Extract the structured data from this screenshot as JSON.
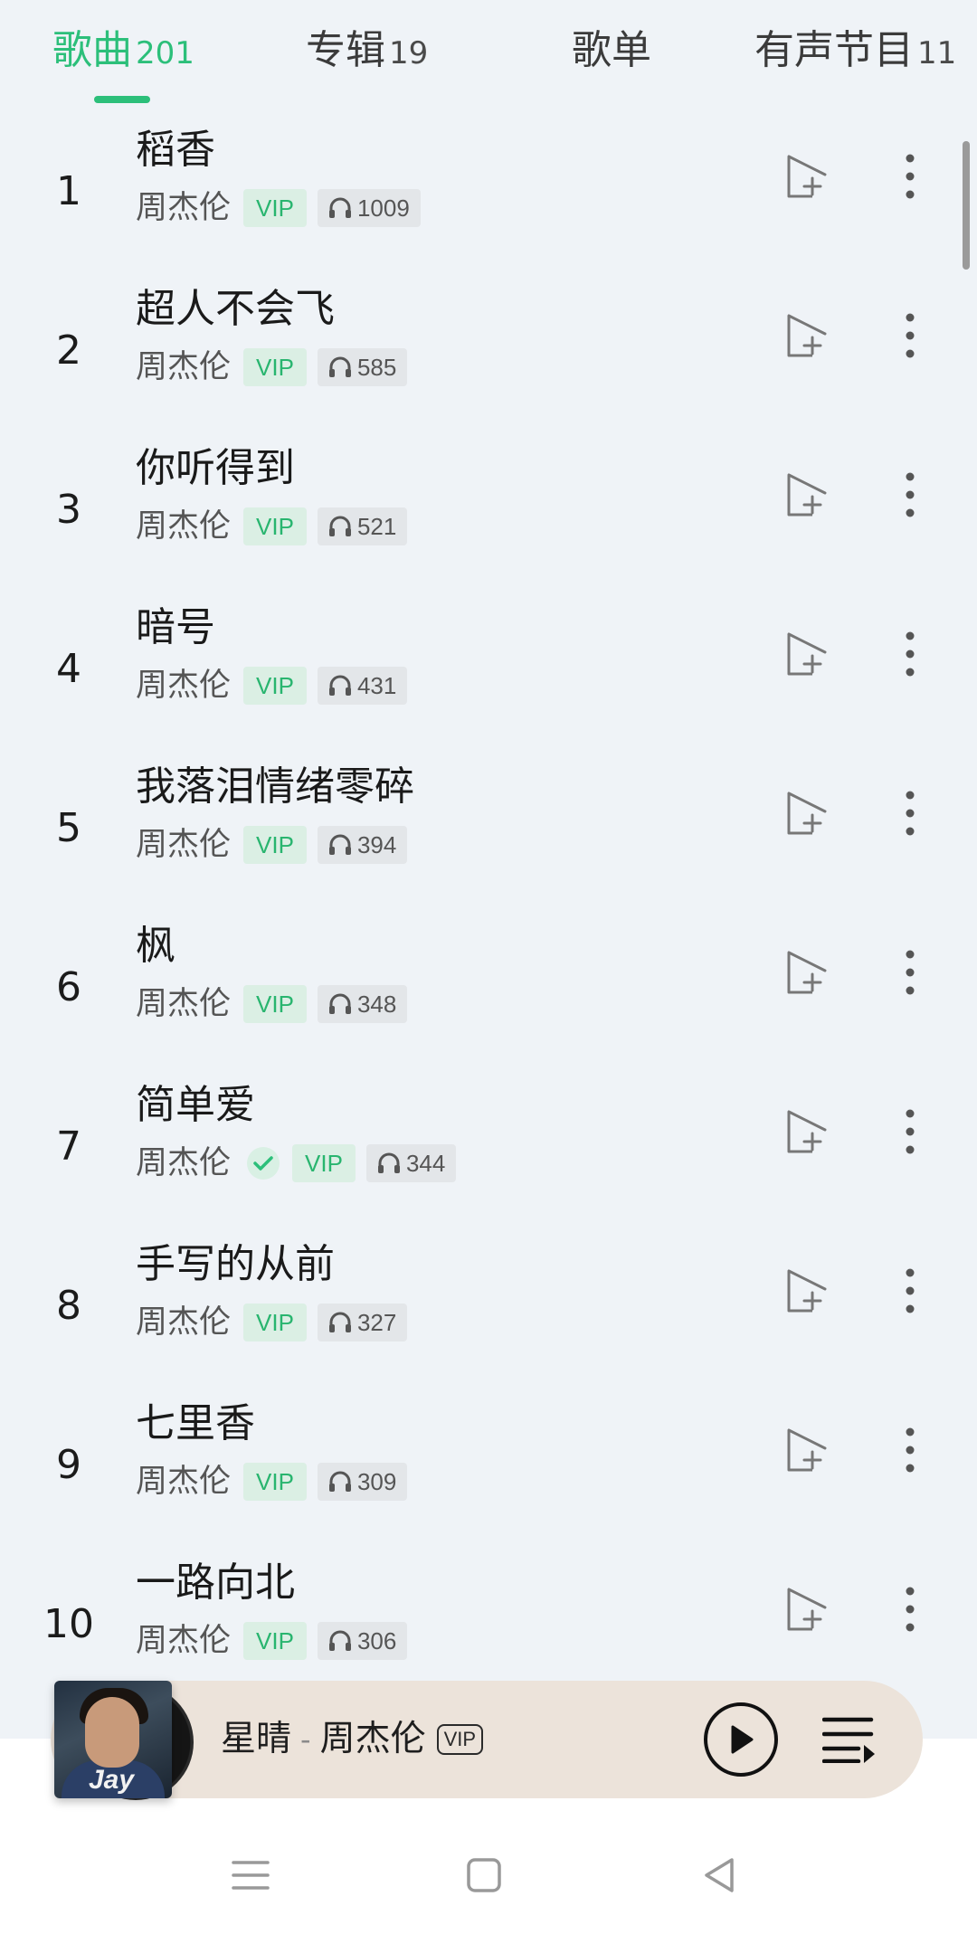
{
  "tabs": [
    {
      "label": "歌曲",
      "count": "201",
      "active": true
    },
    {
      "label": "专辑",
      "count": "19",
      "active": false
    },
    {
      "label": "歌单",
      "count": "",
      "active": false
    },
    {
      "label": "有声节目",
      "count": "11",
      "active": false
    }
  ],
  "songs": [
    {
      "rank": "1",
      "title": "稻香",
      "artist": "周杰伦",
      "vip": "VIP",
      "plays": "1009",
      "verified": false
    },
    {
      "rank": "2",
      "title": "超人不会飞",
      "artist": "周杰伦",
      "vip": "VIP",
      "plays": "585",
      "verified": false
    },
    {
      "rank": "3",
      "title": "你听得到",
      "artist": "周杰伦",
      "vip": "VIP",
      "plays": "521",
      "verified": false
    },
    {
      "rank": "4",
      "title": "暗号",
      "artist": "周杰伦",
      "vip": "VIP",
      "plays": "431",
      "verified": false
    },
    {
      "rank": "5",
      "title": "我落泪情绪零碎",
      "artist": "周杰伦",
      "vip": "VIP",
      "plays": "394",
      "verified": false
    },
    {
      "rank": "6",
      "title": "枫",
      "artist": "周杰伦",
      "vip": "VIP",
      "plays": "348",
      "verified": false
    },
    {
      "rank": "7",
      "title": "简单爱",
      "artist": "周杰伦",
      "vip": "VIP",
      "plays": "344",
      "verified": true
    },
    {
      "rank": "8",
      "title": "手写的从前",
      "artist": "周杰伦",
      "vip": "VIP",
      "plays": "327",
      "verified": false
    },
    {
      "rank": "9",
      "title": "七里香",
      "artist": "周杰伦",
      "vip": "VIP",
      "plays": "309",
      "verified": false
    },
    {
      "rank": "10",
      "title": "一路向北",
      "artist": "周杰伦",
      "vip": "VIP",
      "plays": "306",
      "verified": false
    }
  ],
  "now_playing": {
    "song": "星晴",
    "separator": "-",
    "artist": "周杰伦",
    "vip": "VIP",
    "album_art_text": "Jay"
  },
  "icons": {
    "add_to_playlist": "add-to-playlist-icon",
    "more": "more-vertical-icon",
    "headphones": "headphones-icon",
    "check": "check-icon",
    "play": "play-icon",
    "queue": "playlist-queue-icon",
    "nav_menu": "menu-icon",
    "nav_home": "home-square-icon",
    "nav_back": "back-triangle-icon"
  },
  "colors": {
    "accent": "#2cbf7a",
    "background": "#eff3f7",
    "player_bg": "#ece3da",
    "vip_bg": "#dbefe4",
    "plays_bg": "#e3e6e9"
  }
}
